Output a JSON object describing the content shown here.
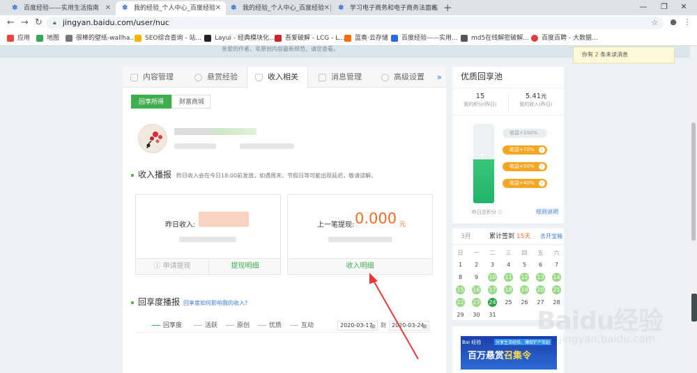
{
  "browser": {
    "tabs": [
      {
        "title": "百度经验——实用生活指南",
        "active": false
      },
      {
        "title": "我的经验_个人中心_百度经验",
        "active": true
      },
      {
        "title": "我的经验_个人中心_百度经验",
        "active": false
      },
      {
        "title": "学习电子商务和电子商务法面临",
        "active": false
      }
    ],
    "url": "jingyan.baidu.com/user/nuc",
    "bookmarks": [
      {
        "label": "应用",
        "color": "#e8453c"
      },
      {
        "label": "地图",
        "color": "#34a853"
      },
      {
        "label": "很棒的壁纸-wallha...",
        "color": "#777777"
      },
      {
        "label": "SEO综合查询 - 站...",
        "color": "#f4b400"
      },
      {
        "label": "Layui - 经典模块化...",
        "color": "#222222"
      },
      {
        "label": "吾爱破解 - LCG - L...",
        "color": "#c62828"
      },
      {
        "label": "蓝奏·云存储",
        "color": "#ff6d00"
      },
      {
        "label": "百度经验——实用...",
        "color": "#2b6bd8"
      },
      {
        "label": "md5在线解密破解...",
        "color": "#555555"
      },
      {
        "label": "百度百聘 - 大数据...",
        "color": "#e53935"
      }
    ]
  },
  "notice": {
    "prefix": "你有",
    "count": "2",
    "suffix": "条未读消息"
  },
  "banner_text": "亲爱的作者，非原创内容最新规范，请您查看。",
  "main_tabs": [
    {
      "label": "内容管理",
      "active": false
    },
    {
      "label": "悬赏经验",
      "active": false
    },
    {
      "label": "收入相关",
      "active": true
    },
    {
      "label": "消息管理",
      "active": false
    },
    {
      "label": "高级设置",
      "active": false
    }
  ],
  "more_tabs": "»",
  "sub_tabs": [
    {
      "label": "回享所得",
      "active": true
    },
    {
      "label": "财富商城",
      "active": false
    }
  ],
  "income": {
    "title": "收入播报",
    "note": "昨日收入会在今日18:00前发放，如遇周末、节假日等可能出现延迟，敬请谅解。",
    "yesterday_label": "昨日收入:",
    "last_withdraw_label": "上一笔提现:",
    "last_withdraw_value": "0.000",
    "unit": "元",
    "apply_withdraw": "申请提现",
    "withdraw_detail": "提现明细",
    "income_detail": "收入明细"
  },
  "share": {
    "title": "回享度播报",
    "link": "回享度如何影响我的收入?",
    "legend": [
      "回享度",
      "活跃",
      "原创",
      "优质",
      "互动"
    ],
    "date_from": "2020-03-17",
    "date_to_label": "到",
    "date_to": "2020-03-24"
  },
  "pool": {
    "title": "优质回享池",
    "points": "15",
    "points_caption": "我的积分(昨日)",
    "income": "5.41",
    "income_unit": "元",
    "income_caption": "我的收入(昨日)",
    "fill_fraction": 0.55,
    "levels": [
      {
        "label": "收益+100%",
        "reached": false
      },
      {
        "label": "收益+70%",
        "reached": true
      },
      {
        "label": "收益+50%",
        "reached": true
      },
      {
        "label": "收益+40%",
        "reached": true
      }
    ],
    "footer_left": "昨日总积分",
    "footer_right": "规则说明"
  },
  "calendar": {
    "month": "3月",
    "streak_prefix": "累计签到",
    "streak_days": "15天",
    "link": "去开宝箱",
    "weekdays": [
      "日",
      "一",
      "二",
      "三",
      "四",
      "五",
      "六"
    ],
    "weeks": [
      [
        "1",
        "2",
        "3",
        "4",
        "5",
        "6",
        "7"
      ],
      [
        "8",
        "9",
        "10",
        "11",
        "12",
        "13",
        "14"
      ],
      [
        "15",
        "16",
        "17",
        "18",
        "19",
        "20",
        "21"
      ],
      [
        "22",
        "23",
        "24",
        "25",
        "26",
        "27",
        "28"
      ],
      [
        "29",
        "30",
        "31",
        "",
        "",
        "",
        ""
      ]
    ],
    "signed_days": [
      "10",
      "11",
      "12",
      "13",
      "14",
      "15",
      "16",
      "17",
      "18",
      "19",
      "20",
      "21",
      "22",
      "23"
    ],
    "today": "24"
  },
  "ad": {
    "logo": "Bai 经验",
    "tag": "分享生活经验，赚取铲产奖励",
    "headline_white": "百万悬赏",
    "headline_yellow": "召集令"
  },
  "watermark": {
    "big": "Baidu经验",
    "small": "jingyan.baidu.com"
  },
  "colors": {
    "green": "#3eae4e",
    "orange": "#f06c22",
    "link_blue": "#3a7be0",
    "annotation_red": "#e53935"
  }
}
